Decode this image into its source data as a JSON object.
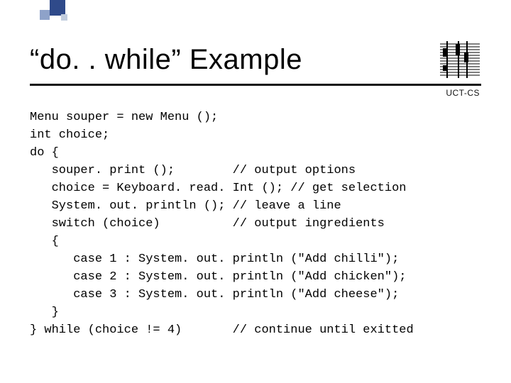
{
  "title": "“do. . while” Example",
  "subtitle": "UCT-CS",
  "code": {
    "l1": "Menu souper = new Menu ();",
    "l2": "int choice;",
    "l3": "do {",
    "l4": "   souper. print ();        // output options",
    "l5": "   choice = Keyboard. read. Int (); // get selection",
    "l6": "   System. out. println (); // leave a line",
    "l7": "   switch (choice)          // output ingredients",
    "l8": "   {",
    "l9": "      case 1 : System. out. println (\"Add chilli\");",
    "l10": "      case 2 : System. out. println (\"Add chicken\");",
    "l11": "      case 3 : System. out. println (\"Add cheese\");",
    "l12": "   }",
    "l13": "} while (choice != 4)       // continue until exitted"
  }
}
